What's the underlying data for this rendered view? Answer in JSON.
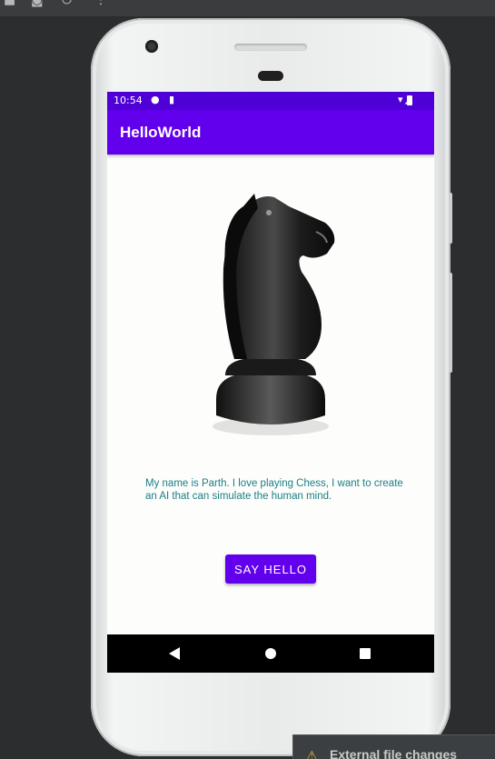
{
  "ide": {
    "toolbar_icons": [
      "stop-icon",
      "camera-icon",
      "power-icon",
      "more-vert-icon"
    ],
    "notification_text": "External file changes",
    "notification_icon": "warning-icon"
  },
  "device": {
    "status_bar": {
      "time": "10:54",
      "icons_left": [
        "message-icon",
        "sd-card-icon"
      ],
      "icons_right": [
        "wifi-icon",
        "signal-icon",
        "battery-icon"
      ]
    },
    "app_bar": {
      "title": "HelloWorld"
    },
    "content": {
      "image": "chess-knight",
      "bio": "My name is Parth. I love playing Chess, I want to create an AI that can simulate the human mind.",
      "button_label": "SAY HELLO"
    },
    "nav_bar": [
      "back",
      "home",
      "recents"
    ]
  },
  "colors": {
    "primary": "#6200ee",
    "status_bar": "#4e00d6",
    "text_teal": "#1a7f86",
    "background": "#fdfdfb"
  }
}
